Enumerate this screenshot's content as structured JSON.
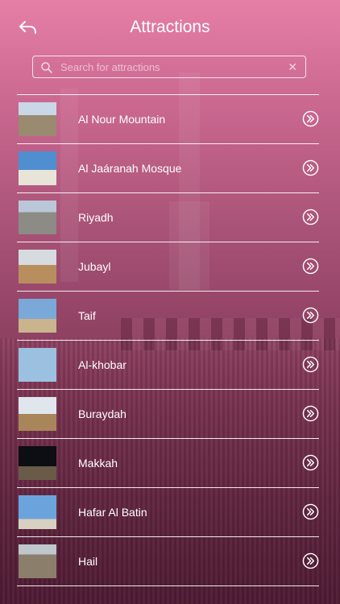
{
  "header": {
    "title": "Attractions"
  },
  "search": {
    "placeholder": "Search for attractions",
    "value": ""
  },
  "attractions": [
    {
      "name": "Al Nour Mountain",
      "thumb": "mountain"
    },
    {
      "name": "Al Jaáranah Mosque",
      "thumb": "mosque"
    },
    {
      "name": "Riyadh",
      "thumb": "city-skyline"
    },
    {
      "name": "Jubayl",
      "thumb": "desert"
    },
    {
      "name": "Taif",
      "thumb": "minaret"
    },
    {
      "name": "Al-khobar",
      "thumb": "towers"
    },
    {
      "name": "Buraydah",
      "thumb": "monument"
    },
    {
      "name": "Makkah",
      "thumb": "kaaba-night"
    },
    {
      "name": "Hafar Al Batin",
      "thumb": "sail-building"
    },
    {
      "name": "Hail",
      "thumb": "old-town"
    }
  ],
  "colors": {
    "accent": "#ffffff",
    "background_top": "#e67fa6",
    "background_bottom": "#5c2440"
  }
}
